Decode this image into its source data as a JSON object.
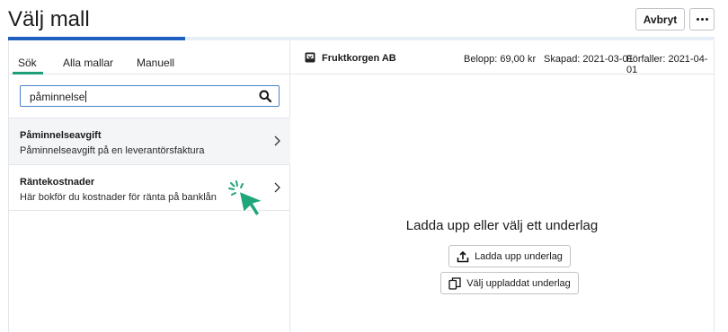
{
  "header": {
    "title": "Välj mall",
    "cancel_label": "Avbryt",
    "more_icon": "more-horizontal-icon",
    "progress_fraction": 0.25
  },
  "tabs": [
    {
      "label": "Sök",
      "active": true
    },
    {
      "label": "Alla mallar",
      "active": false
    },
    {
      "label": "Manuell",
      "active": false
    }
  ],
  "search": {
    "value": "påminnelse",
    "icon": "search-icon"
  },
  "results": [
    {
      "title": "Påminnelseavgift",
      "description": "Påminnelseavgift på en leverantörsfaktura"
    },
    {
      "title": "Räntekostnader",
      "description": "Här bokför du kostnader för ränta på banklån"
    }
  ],
  "document": {
    "supplier": "Fruktkorgen AB",
    "amount": "Belopp: 69,00 kr",
    "created": "Skapad: 2021-03-01",
    "due": "Förfaller: 2021-04-01"
  },
  "upload": {
    "heading": "Ladda upp eller välj ett underlag",
    "upload_button": "Ladda upp underlag",
    "choose_button": "Välj uppladdat underlag"
  },
  "colors": {
    "accent_blue": "#1f5fbf",
    "tab_underline_green": "#1f9e77",
    "cursor_green": "#1fa67a"
  }
}
